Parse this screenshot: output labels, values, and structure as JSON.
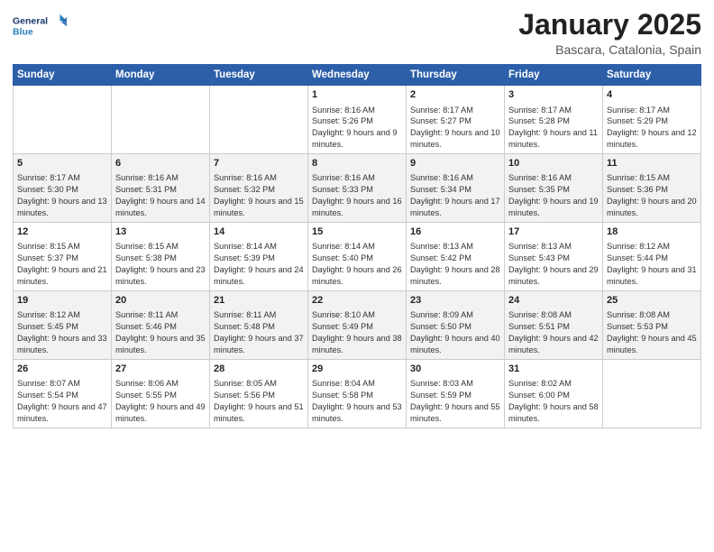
{
  "header": {
    "logo_general": "General",
    "logo_blue": "Blue",
    "month_title": "January 2025",
    "location": "Bascara, Catalonia, Spain"
  },
  "weekdays": [
    "Sunday",
    "Monday",
    "Tuesday",
    "Wednesday",
    "Thursday",
    "Friday",
    "Saturday"
  ],
  "weeks": [
    [
      null,
      null,
      null,
      {
        "day": 1,
        "sunrise": "8:16 AM",
        "sunset": "5:26 PM",
        "daylight": "9 hours and 9 minutes."
      },
      {
        "day": 2,
        "sunrise": "8:17 AM",
        "sunset": "5:27 PM",
        "daylight": "9 hours and 10 minutes."
      },
      {
        "day": 3,
        "sunrise": "8:17 AM",
        "sunset": "5:28 PM",
        "daylight": "9 hours and 11 minutes."
      },
      {
        "day": 4,
        "sunrise": "8:17 AM",
        "sunset": "5:29 PM",
        "daylight": "9 hours and 12 minutes."
      }
    ],
    [
      {
        "day": 5,
        "sunrise": "8:17 AM",
        "sunset": "5:30 PM",
        "daylight": "9 hours and 13 minutes."
      },
      {
        "day": 6,
        "sunrise": "8:16 AM",
        "sunset": "5:31 PM",
        "daylight": "9 hours and 14 minutes."
      },
      {
        "day": 7,
        "sunrise": "8:16 AM",
        "sunset": "5:32 PM",
        "daylight": "9 hours and 15 minutes."
      },
      {
        "day": 8,
        "sunrise": "8:16 AM",
        "sunset": "5:33 PM",
        "daylight": "9 hours and 16 minutes."
      },
      {
        "day": 9,
        "sunrise": "8:16 AM",
        "sunset": "5:34 PM",
        "daylight": "9 hours and 17 minutes."
      },
      {
        "day": 10,
        "sunrise": "8:16 AM",
        "sunset": "5:35 PM",
        "daylight": "9 hours and 19 minutes."
      },
      {
        "day": 11,
        "sunrise": "8:15 AM",
        "sunset": "5:36 PM",
        "daylight": "9 hours and 20 minutes."
      }
    ],
    [
      {
        "day": 12,
        "sunrise": "8:15 AM",
        "sunset": "5:37 PM",
        "daylight": "9 hours and 21 minutes."
      },
      {
        "day": 13,
        "sunrise": "8:15 AM",
        "sunset": "5:38 PM",
        "daylight": "9 hours and 23 minutes."
      },
      {
        "day": 14,
        "sunrise": "8:14 AM",
        "sunset": "5:39 PM",
        "daylight": "9 hours and 24 minutes."
      },
      {
        "day": 15,
        "sunrise": "8:14 AM",
        "sunset": "5:40 PM",
        "daylight": "9 hours and 26 minutes."
      },
      {
        "day": 16,
        "sunrise": "8:13 AM",
        "sunset": "5:42 PM",
        "daylight": "9 hours and 28 minutes."
      },
      {
        "day": 17,
        "sunrise": "8:13 AM",
        "sunset": "5:43 PM",
        "daylight": "9 hours and 29 minutes."
      },
      {
        "day": 18,
        "sunrise": "8:12 AM",
        "sunset": "5:44 PM",
        "daylight": "9 hours and 31 minutes."
      }
    ],
    [
      {
        "day": 19,
        "sunrise": "8:12 AM",
        "sunset": "5:45 PM",
        "daylight": "9 hours and 33 minutes."
      },
      {
        "day": 20,
        "sunrise": "8:11 AM",
        "sunset": "5:46 PM",
        "daylight": "9 hours and 35 minutes."
      },
      {
        "day": 21,
        "sunrise": "8:11 AM",
        "sunset": "5:48 PM",
        "daylight": "9 hours and 37 minutes."
      },
      {
        "day": 22,
        "sunrise": "8:10 AM",
        "sunset": "5:49 PM",
        "daylight": "9 hours and 38 minutes."
      },
      {
        "day": 23,
        "sunrise": "8:09 AM",
        "sunset": "5:50 PM",
        "daylight": "9 hours and 40 minutes."
      },
      {
        "day": 24,
        "sunrise": "8:08 AM",
        "sunset": "5:51 PM",
        "daylight": "9 hours and 42 minutes."
      },
      {
        "day": 25,
        "sunrise": "8:08 AM",
        "sunset": "5:53 PM",
        "daylight": "9 hours and 45 minutes."
      }
    ],
    [
      {
        "day": 26,
        "sunrise": "8:07 AM",
        "sunset": "5:54 PM",
        "daylight": "9 hours and 47 minutes."
      },
      {
        "day": 27,
        "sunrise": "8:06 AM",
        "sunset": "5:55 PM",
        "daylight": "9 hours and 49 minutes."
      },
      {
        "day": 28,
        "sunrise": "8:05 AM",
        "sunset": "5:56 PM",
        "daylight": "9 hours and 51 minutes."
      },
      {
        "day": 29,
        "sunrise": "8:04 AM",
        "sunset": "5:58 PM",
        "daylight": "9 hours and 53 minutes."
      },
      {
        "day": 30,
        "sunrise": "8:03 AM",
        "sunset": "5:59 PM",
        "daylight": "9 hours and 55 minutes."
      },
      {
        "day": 31,
        "sunrise": "8:02 AM",
        "sunset": "6:00 PM",
        "daylight": "9 hours and 58 minutes."
      },
      null
    ]
  ],
  "labels": {
    "sunrise": "Sunrise:",
    "sunset": "Sunset:",
    "daylight": "Daylight:"
  }
}
